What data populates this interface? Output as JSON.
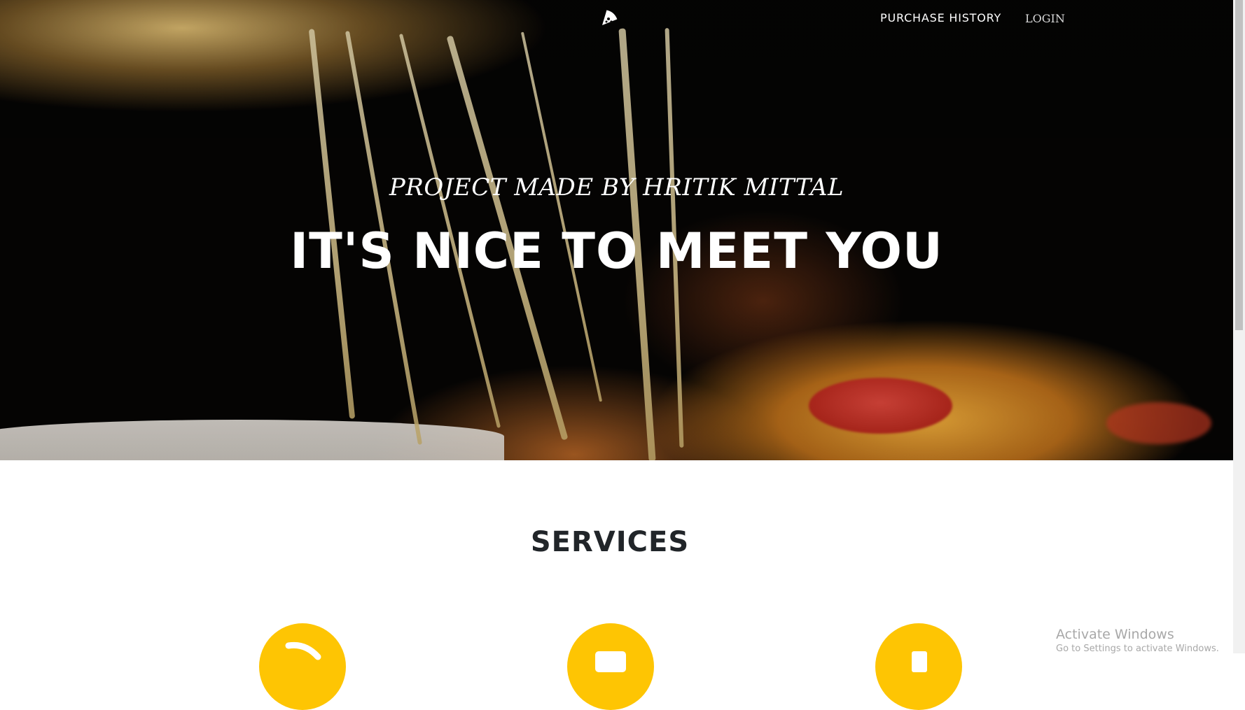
{
  "nav": {
    "purchase_history": "PURCHASE HISTORY",
    "login": "LOGIN"
  },
  "hero": {
    "subheading": "PROJECT MADE BY HRITIK MITTAL",
    "heading": "IT'S NICE TO MEET YOU"
  },
  "services": {
    "title": "SERVICES",
    "icons": [
      "pizza-slice-icon",
      "shopping-cart-icon",
      "laptop-icon"
    ]
  },
  "watermark": {
    "title": "Activate Windows",
    "subtitle": "Go to Settings to activate Windows."
  },
  "colors": {
    "accent": "#fec503",
    "heading_dark": "#212529"
  }
}
